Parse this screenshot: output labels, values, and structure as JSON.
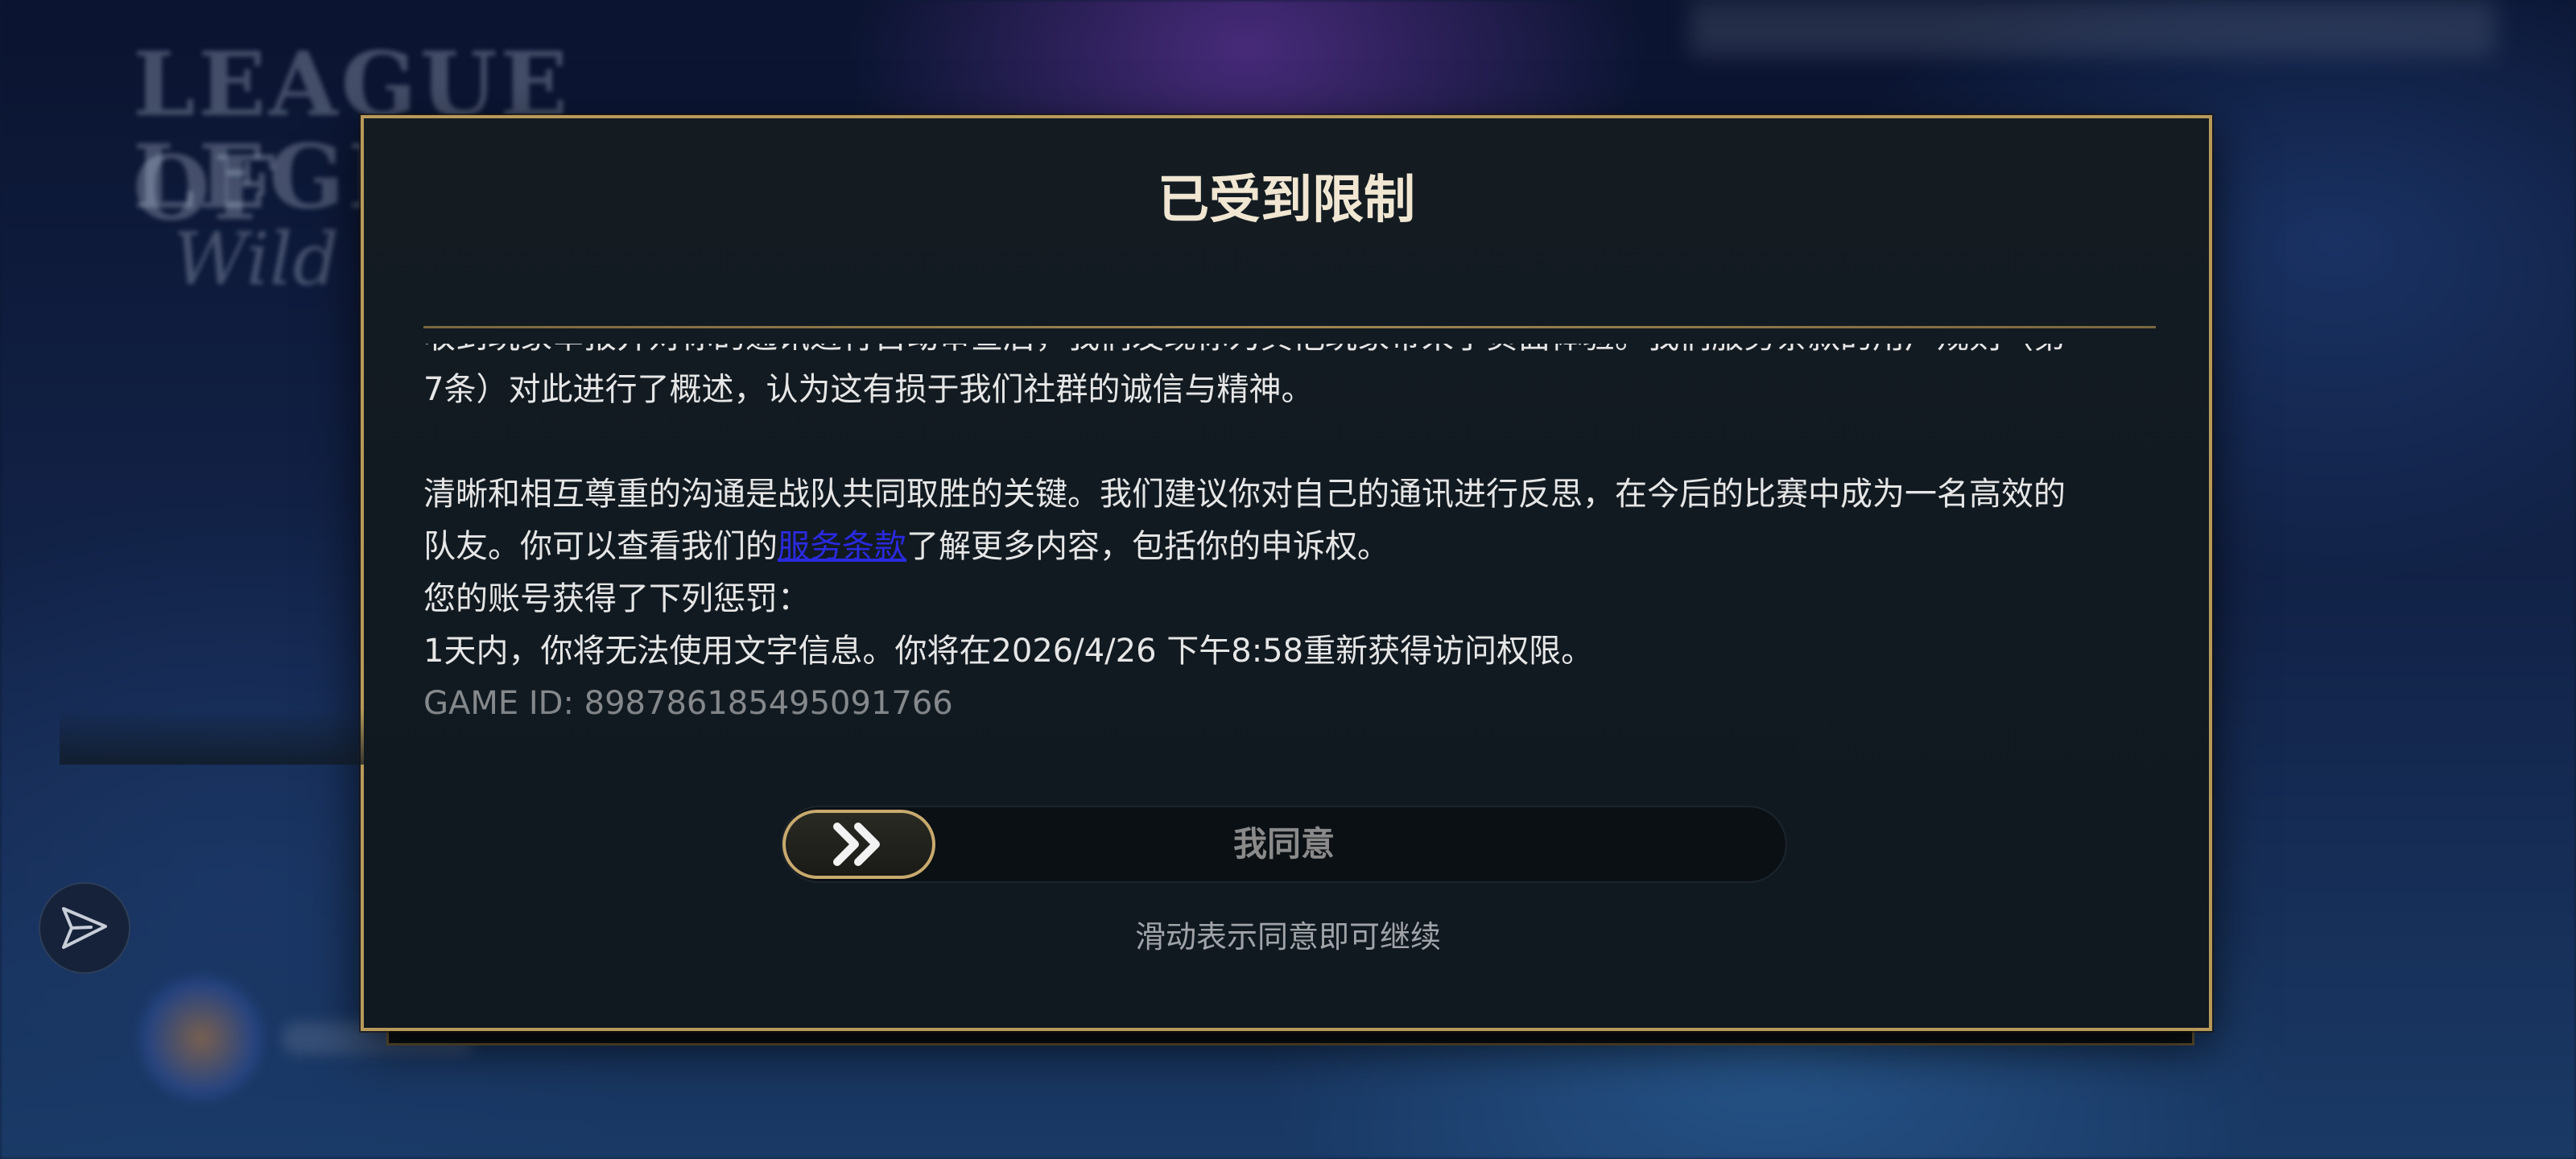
{
  "background": {
    "logo_line1": "LEAGUE OF",
    "logo_line2": "LEGENDS",
    "logo_line3": "Wild Rift"
  },
  "dialog": {
    "title": "已受到限制",
    "paragraphs": {
      "cut_line": "收到玩家举报并对你的通讯进行自动审查后，我们发现你为其他玩家带来了负面体验。我们服务条款的用户规则（第",
      "line2": "7条）对此进行了概述，认为这有损于我们社群的诚信与精神。",
      "advice_line1": "清晰和相互尊重的沟通是战队共同取胜的关键。我们建议你对自己的通讯进行反思，在今后的比赛中成为一名高效的",
      "advice_line2_prefix": "队友。你可以查看我们的",
      "tos_link": "服务条款",
      "advice_line2_suffix": "了解更多内容，包括你的申诉权。",
      "penalty_intro": "您的账号获得了下列惩罚：",
      "penalty_detail": "1天内，你将无法使用文字信息。你将在2026/4/26 下午8:58重新获得访问权限。",
      "game_id": "GAME ID: 898786185495091766"
    },
    "slider": {
      "label": "我同意",
      "handle_icon": "double-chevron-right-icon"
    },
    "hint": "滑动表示同意即可继续"
  },
  "side_button": {
    "icon": "send-icon"
  },
  "colors": {
    "gold_border": "#b79a5a",
    "title_text": "#f0e6d2",
    "link": "#2a2ae0",
    "dialog_bg": "#121a20"
  }
}
